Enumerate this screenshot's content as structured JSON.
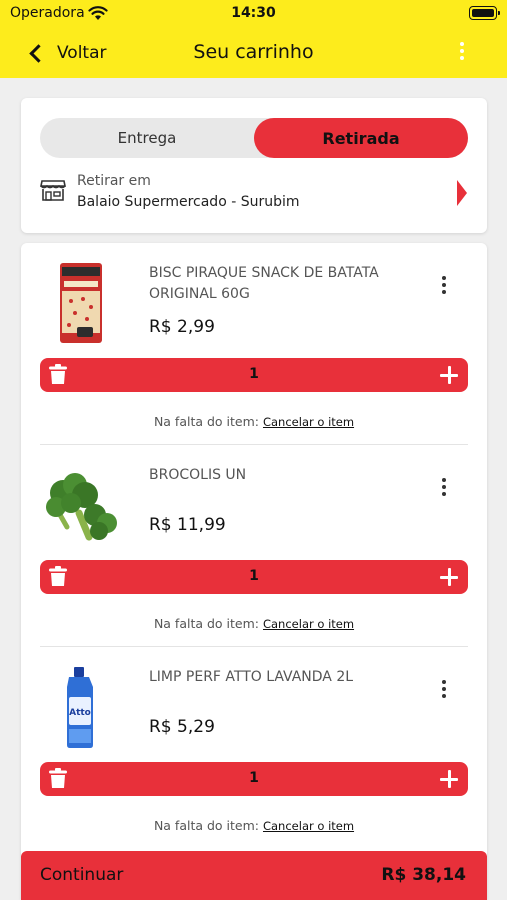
{
  "status_bar": {
    "carrier": "Operadora",
    "time": "14:30"
  },
  "nav": {
    "back_label": "Voltar",
    "title": "Seu carrinho"
  },
  "delivery_mode": {
    "options": [
      "Entrega",
      "Retirada"
    ],
    "selected": "Retirada",
    "pickup_label": "Retirar em",
    "pickup_store": "Balaio Supermercado - Surubim"
  },
  "cart": {
    "items": [
      {
        "name": "BISC PIRAQUE SNACK DE BATATA ORIGINAL 60G",
        "price": "R$ 2,99",
        "quantity": "1",
        "missing_label": "Na falta do item:",
        "missing_action": "Cancelar o item"
      },
      {
        "name": "BROCOLIS UN",
        "price": "R$ 11,99",
        "quantity": "1",
        "missing_label": "Na falta do item:",
        "missing_action": "Cancelar o item"
      },
      {
        "name": "LIMP PERF ATTO LAVANDA 2L",
        "price": "R$ 5,29",
        "quantity": "1",
        "missing_label": "Na falta do item:",
        "missing_action": "Cancelar o item"
      }
    ]
  },
  "footer": {
    "continue_label": "Continuar",
    "total": "R$ 38,14"
  },
  "colors": {
    "header_yellow": "#fdec1c",
    "accent_red": "#e8303a"
  }
}
